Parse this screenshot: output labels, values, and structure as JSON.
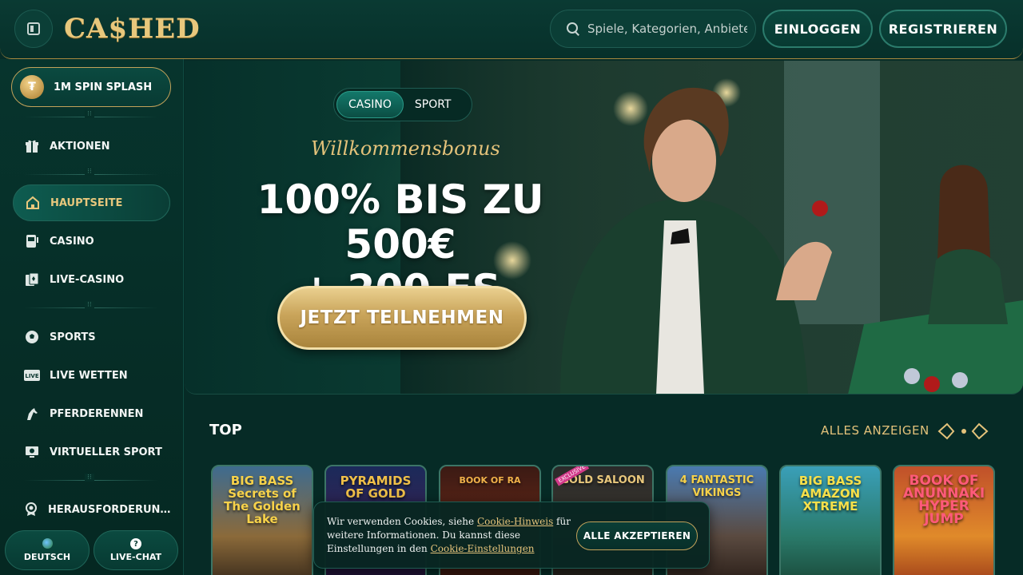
{
  "header": {
    "logo": "CA$HED",
    "search_placeholder": "Spiele, Kategorien, Anbieter",
    "login_label": "EINLOGGEN",
    "register_label": "REGISTRIEREN"
  },
  "sidebar": {
    "promo_label": "1M SPIN SPLASH",
    "items": [
      {
        "label": "AKTIONEN",
        "icon": "gift-icon"
      },
      {
        "label": "HAUPTSEITE",
        "icon": "home-icon",
        "active": true
      },
      {
        "label": "CASINO",
        "icon": "slot-machine-icon"
      },
      {
        "label": "LIVE-CASINO",
        "icon": "cards-icon"
      },
      {
        "label": "SPORTS",
        "icon": "soccer-ball-icon"
      },
      {
        "label": "LIVE WETTEN",
        "icon": "live-icon"
      },
      {
        "label": "PFERDERENNEN",
        "icon": "horse-icon"
      },
      {
        "label": "VIRTUELLER SPORT",
        "icon": "virtual-sport-icon"
      },
      {
        "label": "HERAUSFORDERUN…",
        "icon": "challenge-icon"
      }
    ],
    "language_label": "DEUTSCH",
    "chat_label": "LIVE-CHAT"
  },
  "hero": {
    "tabs": [
      "CASINO",
      "SPORT"
    ],
    "active_tab": "CASINO",
    "welcome": "Willkommensbonus",
    "headline_line1": "100% BIS ZU 500€",
    "headline_line2": "+ 200 FS",
    "cta_label": "JETZT TEILNEHMEN"
  },
  "top_section": {
    "title": "TOP",
    "show_all_label": "ALLES ANZEIGEN",
    "games": [
      {
        "title": "BIG BASS Secrets of The Golden Lake"
      },
      {
        "title": "PYRAMIDS OF GOLD"
      },
      {
        "title": "BOOK OF RA"
      },
      {
        "title": "GOLD SALOON",
        "badge": "EXCLUSIVE"
      },
      {
        "title": "4 FANTASTIC VIKINGS"
      },
      {
        "title": "BIG BASS AMAZON XTREME"
      },
      {
        "title": "BOOK OF ANUNNAKI HYPER JUMP"
      }
    ]
  },
  "cookie": {
    "text_1": "Wir verwenden Cookies, siehe ",
    "link_1": "Cookie-Hinweis",
    "text_2": " für weitere Informationen. Du kannst diese Einstellungen in den ",
    "link_2": "Cookie-Einstellungen",
    "accept_label": "ALLE AKZEPTIEREN"
  },
  "colors": {
    "accent_gold": "#e3c27a",
    "background": "#062b26",
    "panel": "#0b3e36"
  }
}
